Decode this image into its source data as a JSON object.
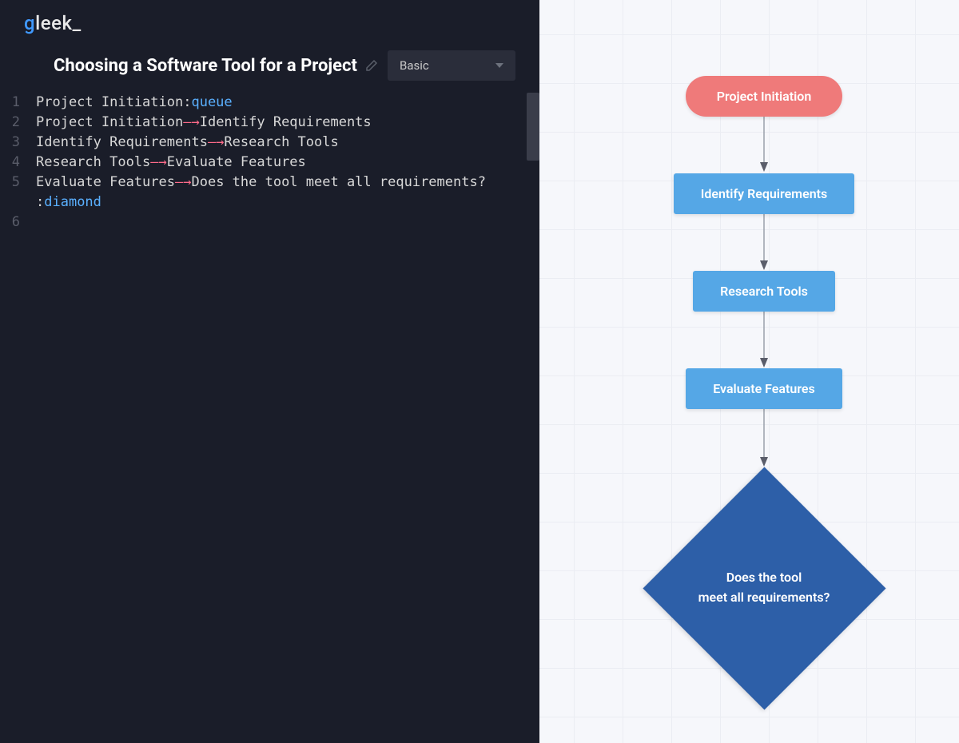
{
  "logo": {
    "pre": "g",
    "rest": "leek_"
  },
  "header": {
    "title": "Choosing a Software Tool for a Project",
    "dropdown_selected": "Basic"
  },
  "editor": {
    "lines": [
      {
        "num": "1",
        "segments": [
          {
            "t": "Project Initiation:",
            "c": "plain"
          },
          {
            "t": "queue",
            "c": "kw"
          }
        ]
      },
      {
        "num": "2",
        "segments": [
          {
            "t": "Project Initiation",
            "c": "plain"
          },
          {
            "t": "—→",
            "c": "arrow"
          },
          {
            "t": "Identify Requirements",
            "c": "plain"
          }
        ]
      },
      {
        "num": "3",
        "segments": [
          {
            "t": "Identify Requirements",
            "c": "plain"
          },
          {
            "t": "—→",
            "c": "arrow"
          },
          {
            "t": "Research Tools",
            "c": "plain"
          }
        ]
      },
      {
        "num": "4",
        "segments": [
          {
            "t": "Research Tools",
            "c": "plain"
          },
          {
            "t": "—→",
            "c": "arrow"
          },
          {
            "t": "Evaluate Features",
            "c": "plain"
          }
        ]
      },
      {
        "num": "5",
        "segments": [
          {
            "t": "Evaluate Features",
            "c": "plain"
          },
          {
            "t": "—→",
            "c": "arrow"
          },
          {
            "t": "Does the tool meet all requirements?",
            "c": "plain"
          }
        ]
      },
      {
        "num": "",
        "segments": [
          {
            "t": ":",
            "c": "plain"
          },
          {
            "t": "diamond",
            "c": "kw"
          }
        ]
      },
      {
        "num": "6",
        "segments": []
      }
    ]
  },
  "diagram": {
    "nodes": {
      "start": {
        "label": "Project Initiation"
      },
      "step1": {
        "label": "Identify Requirements"
      },
      "step2": {
        "label": "Research Tools"
      },
      "step3": {
        "label": "Evaluate Features"
      },
      "decision_line1": "Does the tool",
      "decision_line2": "meet all requirements?"
    }
  },
  "colors": {
    "start": "#ef7a7a",
    "step": "#55a7e6",
    "decision": "#2d5fa8",
    "arrow": "#9aa0ab"
  }
}
